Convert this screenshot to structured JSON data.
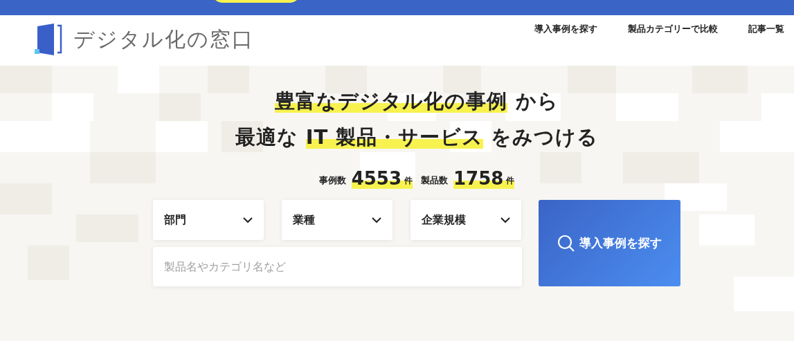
{
  "header": {
    "logo_text": "デジタル化の窓口",
    "nav": [
      "導入事例を探す",
      "製品カテゴリーで比較",
      "記事一覧"
    ]
  },
  "hero": {
    "headline": [
      [
        {
          "text": "豊富なデジタル化の事例",
          "highlighted": true
        },
        {
          "text": " から",
          "highlighted": false
        }
      ],
      [
        {
          "text": "最適な ",
          "highlighted": false
        },
        {
          "text": "IT 製品・サービス",
          "highlighted": true
        },
        {
          "text": " をみつける",
          "highlighted": false
        }
      ]
    ],
    "stats": [
      {
        "label": "事例数",
        "value": "4553",
        "unit": "件"
      },
      {
        "label": "製品数",
        "value": "1758",
        "unit": "件"
      }
    ]
  },
  "search": {
    "dropdowns": [
      "部門",
      "業種",
      "企業規模"
    ],
    "placeholder": "製品名やカテゴリ名など",
    "button": "導入事例を探す"
  }
}
